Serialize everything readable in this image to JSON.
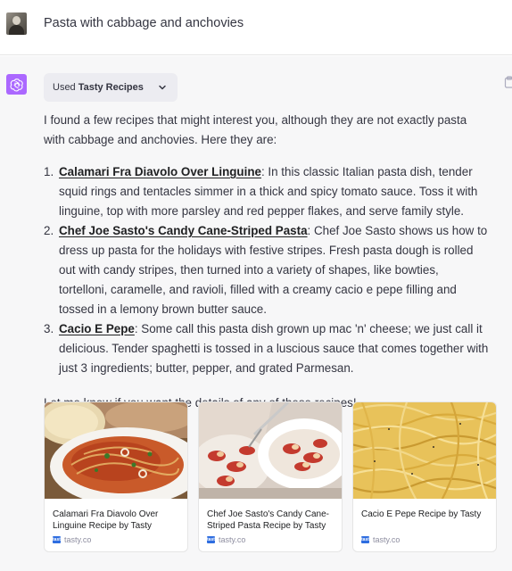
{
  "user_message": {
    "text": "Pasta with cabbage and anchovies"
  },
  "assistant": {
    "tool_chip": {
      "prefix": "Used",
      "plugin": "Tasty Recipes"
    },
    "intro": "I found a few recipes that might interest you, although they are not exactly pasta with cabbage and anchovies. Here they are:",
    "recipes": [
      {
        "number": "1.",
        "name": "Calamari Fra Diavolo Over Linguine",
        "description": ": In this classic Italian pasta dish, tender squid rings and tentacles simmer in a thick and spicy tomato sauce. Toss it with linguine, top with more parsley and red pepper flakes, and serve family style."
      },
      {
        "number": "2.",
        "name": "Chef Joe Sasto's Candy Cane-Striped Pasta",
        "description": ": Chef Joe Sasto shows us how to dress up pasta for the holidays with festive stripes. Fresh pasta dough is rolled out with candy stripes, then turned into a variety of shapes, like bowties, tortelloni, caramelle, and ravioli, filled with a creamy cacio e pepe filling and tossed in a lemony brown butter sauce."
      },
      {
        "number": "3.",
        "name": "Cacio E Pepe",
        "description": ": Some call this pasta dish grown up mac 'n' cheese; we just call it delicious. Tender spaghetti is tossed in a luscious sauce that comes together with just 3 ingredients; butter, pepper, and grated Parmesan."
      }
    ],
    "outro": "Let me know if you want the details of any of these recipes!",
    "cards": [
      {
        "title": "Calamari Fra Diavolo Over Linguine Recipe by Tasty",
        "source": "tasty.co",
        "favicon_text": "tasty"
      },
      {
        "title": "Chef Joe Sasto's Candy Cane-Striped Pasta Recipe by Tasty",
        "source": "tasty.co",
        "favicon_text": "tasty"
      },
      {
        "title": "Cacio E Pepe Recipe by Tasty",
        "source": "tasty.co",
        "favicon_text": "tasty"
      }
    ]
  },
  "icons": {
    "assistant_avatar": "openai-logo-icon",
    "tool_chevron": "chevron-down-icon",
    "copy": "clipboard-icon"
  },
  "colors": {
    "assistant_avatar_bg": "#ab68ff",
    "assistant_bg": "#f7f7f8",
    "chip_bg": "#ececf1",
    "text": "#343541"
  }
}
